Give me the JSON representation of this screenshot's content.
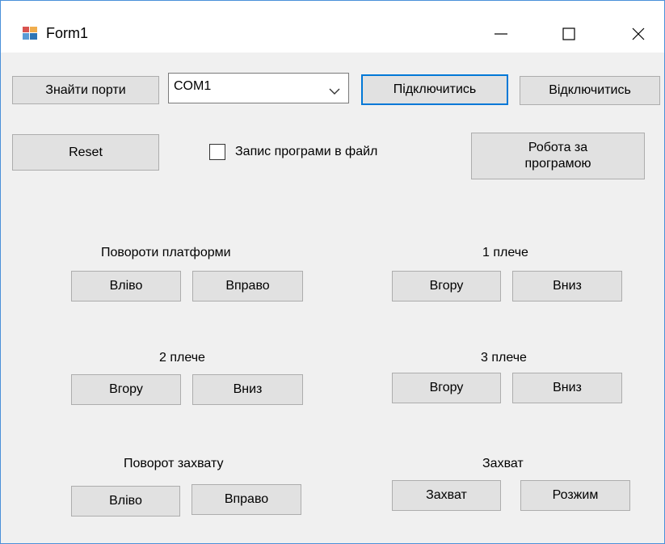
{
  "window": {
    "title": "Form1",
    "controls": {
      "minimize": "minimize-icon",
      "maximize": "maximize-icon",
      "close": "close-icon"
    }
  },
  "toolbar": {
    "find_ports": "Знайти порти",
    "port_select": {
      "value": "COM1",
      "icon": "chevron-down-icon"
    },
    "connect": "Підключитись",
    "disconnect": "Відключитись"
  },
  "row2": {
    "reset": "Reset",
    "record_checkbox": {
      "label": "Запис програми в файл",
      "checked": false
    },
    "run_program": "Робота за програмою"
  },
  "groups": {
    "platform": {
      "title": "Повороти платформи",
      "left": "Вліво",
      "right": "Вправо"
    },
    "shoulder1": {
      "title": "1 плече",
      "up": "Вгору",
      "down": "Вниз"
    },
    "shoulder2": {
      "title": "2 плече",
      "up": "Вгору",
      "down": "Вниз"
    },
    "shoulder3": {
      "title": "3 плече",
      "up": "Вгору",
      "down": "Вниз"
    },
    "grip_rotate": {
      "title": "Поворот захвату",
      "left": "Вліво",
      "right": "Вправо"
    },
    "grip": {
      "title": "Захват",
      "grab": "Захват",
      "release": "Розжим"
    }
  },
  "colors": {
    "form_bg": "#f0f0f0",
    "button_bg": "#e1e1e1",
    "button_border": "#adadad",
    "focus_border": "#0078d7",
    "window_border": "#4a90d9"
  }
}
